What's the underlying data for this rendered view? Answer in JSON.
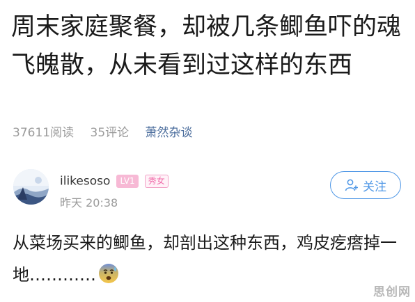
{
  "article": {
    "title": "周末家庭聚餐，却被几条鲫鱼吓的魂飞魄散，从未看到过这样的东西",
    "reads": "37611阅读",
    "comments": "35评论",
    "source": "萧然杂谈"
  },
  "author": {
    "name": "ilikesoso",
    "level_badge": "LV1",
    "tag_badge": "秀女",
    "time": "昨天 20:38",
    "follow_label": "关注"
  },
  "post": {
    "text": "从菜场买来的鲫鱼，却剖出这种东西，鸡皮疙瘩掉一地…………",
    "emoji": "anxious-sweat-emoji"
  },
  "watermark": "思创网",
  "colors": {
    "accent_blue": "#4f97e6",
    "source_blue": "#4a6c9c",
    "badge_pink": "#f06aa8",
    "meta_gray": "#9b9b9b"
  }
}
